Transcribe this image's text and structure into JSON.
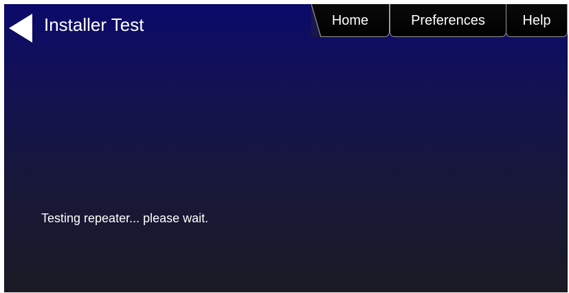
{
  "header": {
    "title": "Installer Test"
  },
  "nav": {
    "tabs": [
      {
        "label": "Home"
      },
      {
        "label": "Preferences"
      },
      {
        "label": "Help"
      }
    ]
  },
  "main": {
    "status_text": "Testing repeater... please wait."
  },
  "icons": {
    "back": "back-arrow-icon"
  },
  "colors": {
    "background_top": "#0b0a6a",
    "background_bottom": "#1a1a24",
    "tab_background": "#000000",
    "tab_border": "#9a9a9a",
    "text": "#ffffff"
  }
}
